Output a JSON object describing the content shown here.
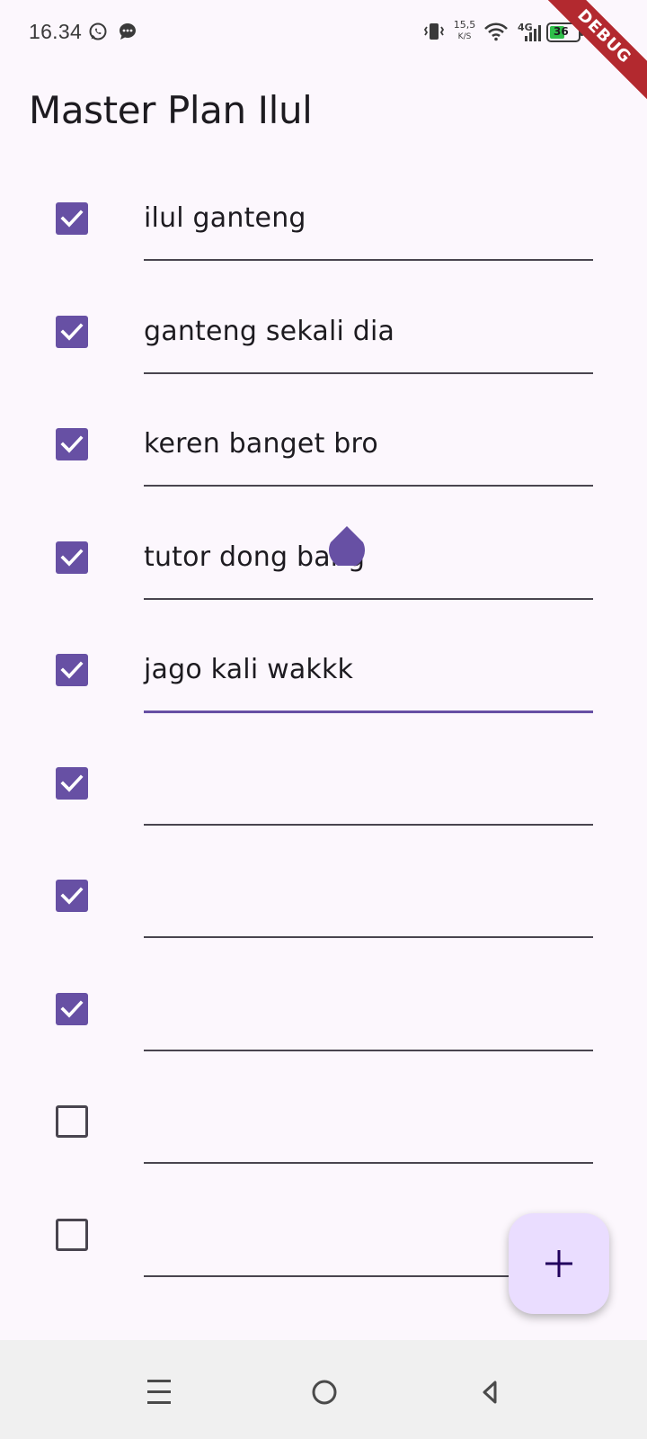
{
  "status_bar": {
    "time": "16.34",
    "net_speed_value": "15,5",
    "net_speed_unit": "K/S",
    "network_type": "4G",
    "battery_level": "36",
    "left_icons": [
      "whatsapp-icon",
      "message-bubble-icon"
    ],
    "right_icons": [
      "vibrate-icon",
      "wifi-icon",
      "signal-icon",
      "battery-icon",
      "charging-icon"
    ]
  },
  "debug_banner": "DEBUG",
  "app_bar": {
    "title": "Master Plan Ilul"
  },
  "tasks": [
    {
      "text": "ilul ganteng",
      "done": true
    },
    {
      "text": "ganteng sekali dia",
      "done": true
    },
    {
      "text": "keren banget bro",
      "done": true
    },
    {
      "text": "tutor dong bang",
      "done": true
    },
    {
      "text": "jago kali wakkk",
      "done": true,
      "focused": true
    },
    {
      "text": "",
      "done": true
    },
    {
      "text": "",
      "done": true
    },
    {
      "text": "",
      "done": true
    },
    {
      "text": "",
      "done": false
    },
    {
      "text": "",
      "done": false
    }
  ],
  "fab": {
    "icon": "plus-icon"
  },
  "nav_bar": {
    "icons": [
      "recents-icon",
      "home-icon",
      "back-icon"
    ]
  },
  "colors": {
    "background": "#fcf7fd",
    "primary": "#6750a4",
    "fab_container": "#eaddff",
    "on_surface": "#1d1b20",
    "outline": "#49454f",
    "debug_banner": "#b3292f",
    "nav_bar": "#f0f0f0"
  }
}
